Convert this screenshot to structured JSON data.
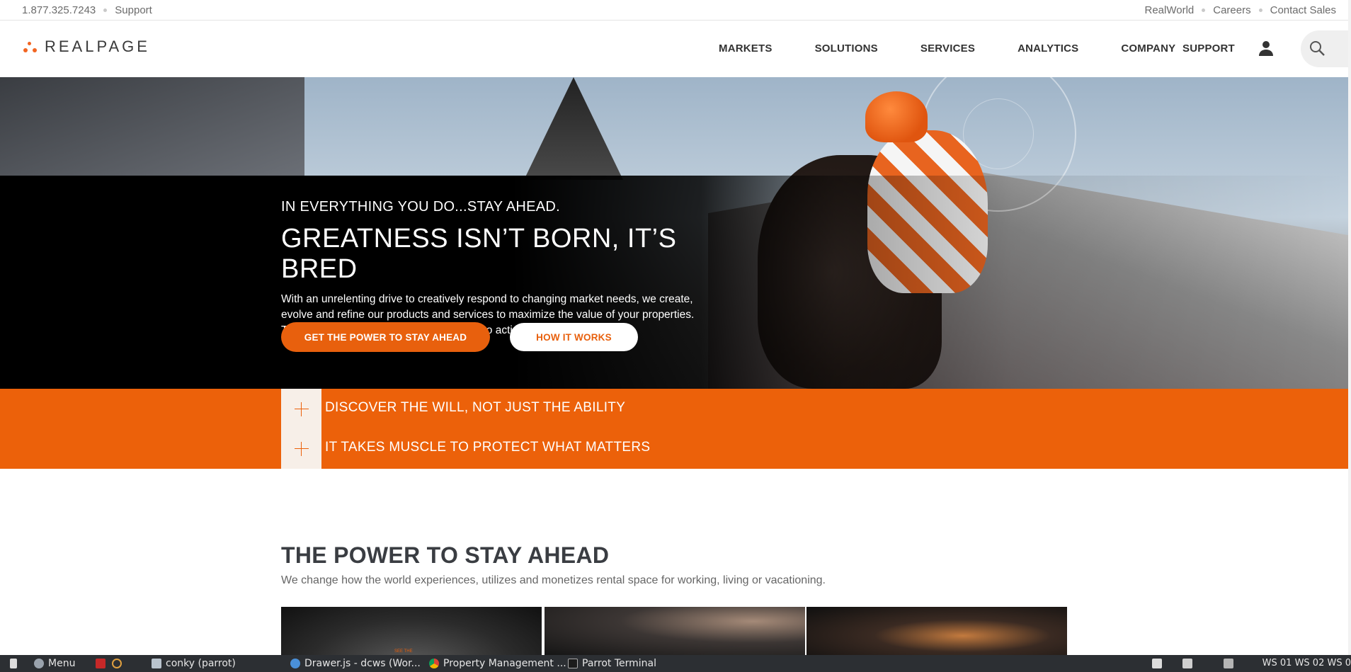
{
  "utility": {
    "phone": "1.877.325.7243",
    "support": "Support",
    "right_links": [
      "RealWorld",
      "Careers",
      "Contact Sales"
    ]
  },
  "header": {
    "logo_text": "REALPAGE",
    "nav": [
      "MARKETS",
      "SOLUTIONS",
      "SERVICES",
      "ANALYTICS",
      "COMPANY"
    ],
    "nav_support": "SUPPORT",
    "icons": [
      "user-icon",
      "search-icon"
    ]
  },
  "hero": {
    "eyebrow": "IN EVERYTHING YOU DO...STAY AHEAD.",
    "headline": "GREATNESS ISN’T BORN, IT’S BRED",
    "body": "With an unrelenting drive to creatively respond to changing market needs, we create, evolve and refine our products and services to maximize the value of your properties. Turn analytics into insights and insights into action starting now.",
    "cta_primary": "GET THE POWER TO STAY AHEAD",
    "cta_secondary": "HOW IT WORKS"
  },
  "accordions": [
    {
      "label": "DISCOVER THE WILL, NOT JUST THE ABILITY"
    },
    {
      "label": "IT TAKES MUSCLE TO PROTECT WHAT MATTERS"
    }
  ],
  "section": {
    "title": "THE POWER TO STAY AHEAD",
    "subtitle": "We change how the world experiences, utilizes and monetizes rental space for working, living or vacationing.",
    "card1_tiny": "SEE THE"
  },
  "taskbar": {
    "menu": "Menu",
    "items": [
      "conky (parrot)",
      "Drawer.js - dcws (Wor...",
      "Property Management ...",
      "Parrot Terminal"
    ],
    "workspaces": "WS  01 WS  02 WS  0"
  },
  "colors": {
    "brand_orange": "#ec610a",
    "text_dark": "#3a3d42"
  }
}
